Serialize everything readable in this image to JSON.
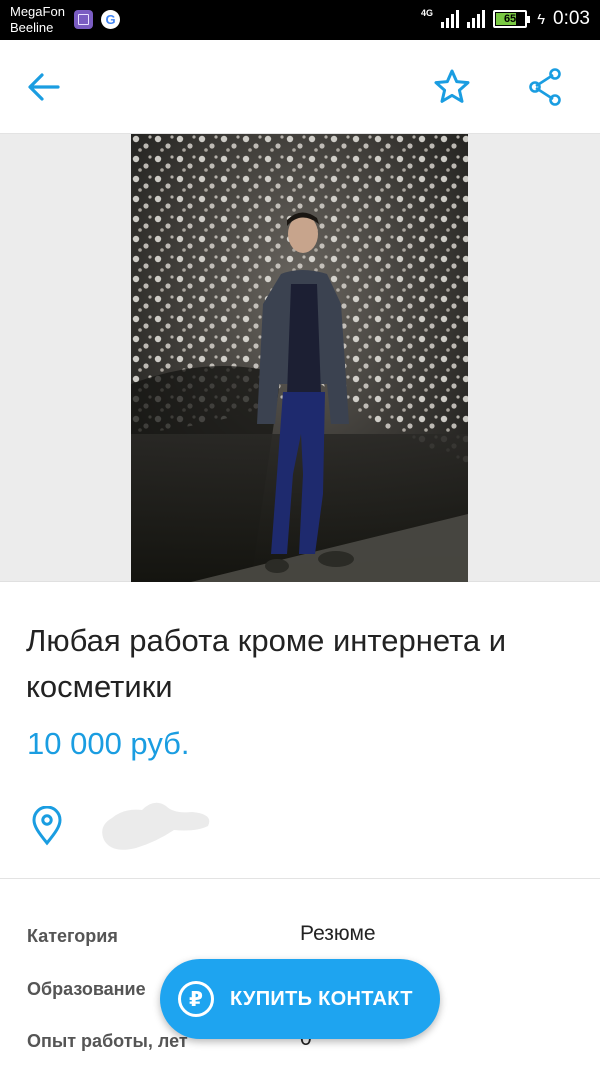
{
  "status_bar": {
    "carrier_1": "MegaFon",
    "carrier_2": "Beeline",
    "network": "4G",
    "battery": "65",
    "time": "0:03"
  },
  "toolbar": {
    "back_icon": "arrow-left-icon",
    "favorite_icon": "star-outline-icon",
    "share_icon": "share-icon",
    "accent_color": "#1a9de1"
  },
  "listing": {
    "title": "Любая работа кроме интернета и косметики",
    "price": "10 000 руб.",
    "location_icon": "map-pin-icon"
  },
  "params": [
    {
      "label": "Категория",
      "value": "Резюме"
    },
    {
      "label": "Образование",
      "value": ""
    },
    {
      "label": "Опыт работы, лет",
      "value": "0"
    }
  ],
  "fab": {
    "label": "КУПИТЬ КОНТАКТ",
    "icon_glyph": "₽",
    "color": "#1ea4f0"
  }
}
